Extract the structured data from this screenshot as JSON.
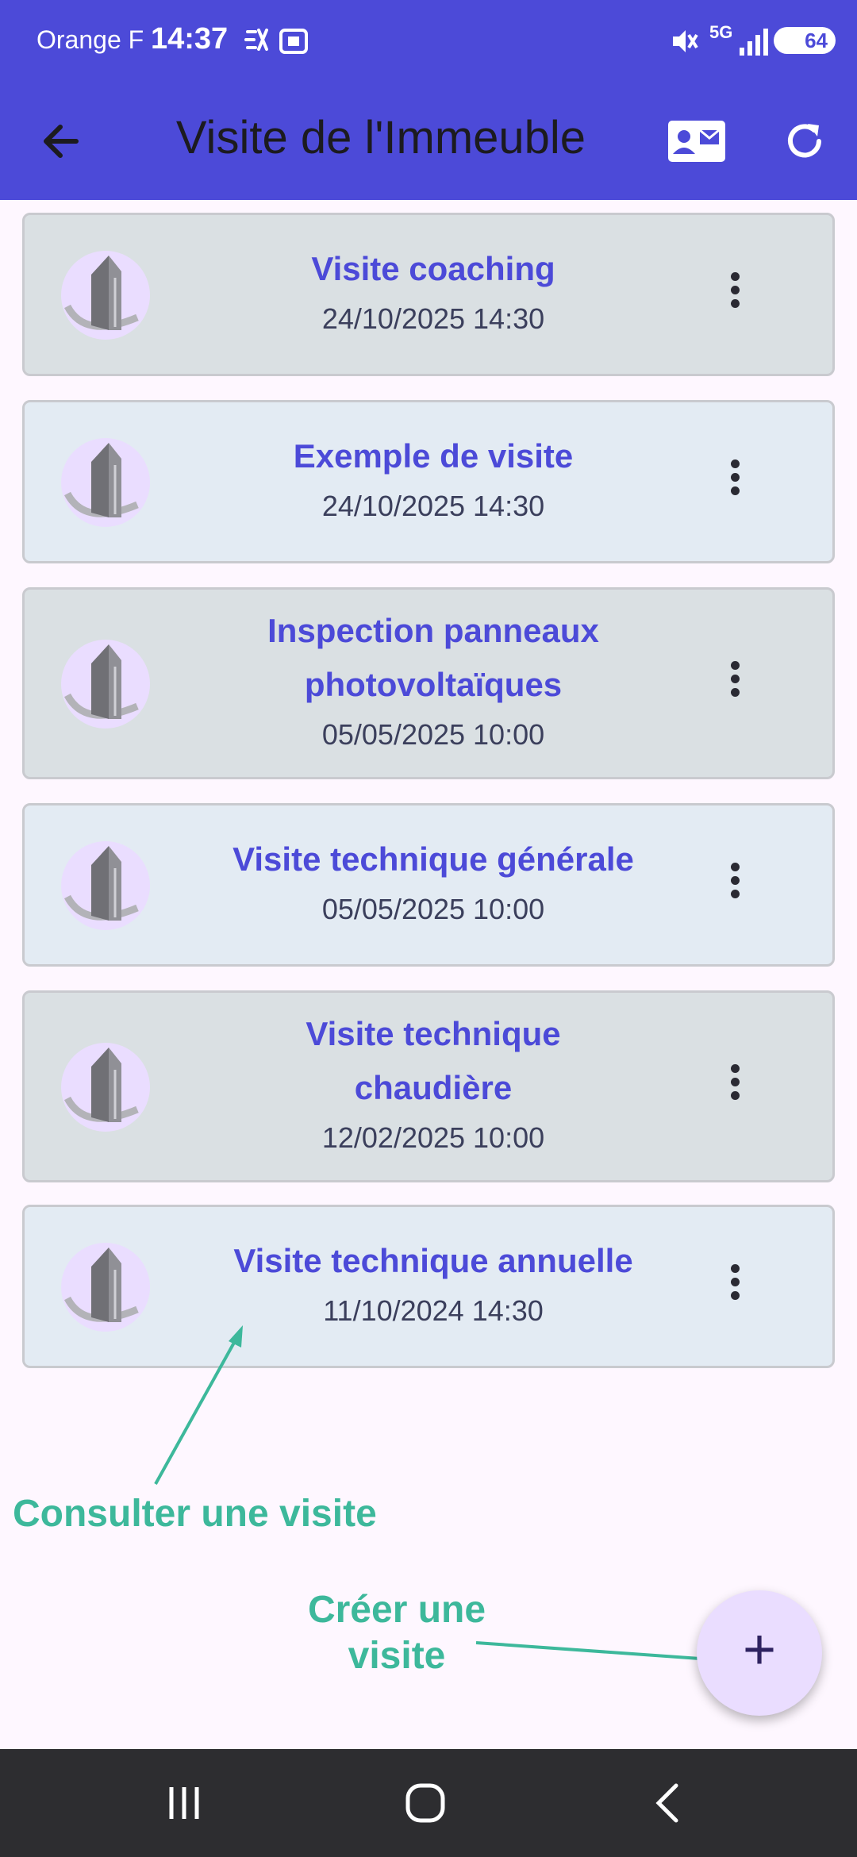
{
  "status_bar": {
    "carrier": "Orange F",
    "time": "14:37",
    "network": "5G",
    "battery": "64"
  },
  "app_bar": {
    "title": "Visite de l'Immeuble",
    "color": "#4C4AD8"
  },
  "visits": [
    {
      "title": "Visite coaching",
      "date": "24/10/2025 14:30"
    },
    {
      "title": "Exemple de visite",
      "date": "24/10/2025 14:30"
    },
    {
      "title": "Inspection panneaux photovoltaïques",
      "date": "05/05/2025 10:00"
    },
    {
      "title": "Visite technique générale",
      "date": "05/05/2025 10:00"
    },
    {
      "title": "Visite technique chaudière",
      "date": "12/02/2025 10:00"
    },
    {
      "title": "Visite technique annuelle",
      "date": "11/10/2024 14:30"
    }
  ],
  "annotations": {
    "consult": "Consulter une visite",
    "create": "Créer une visite",
    "color": "#3DB89B"
  },
  "fab": {
    "symbol": "+"
  },
  "icons": {
    "back": "arrow-left-icon",
    "contact": "contact-card-icon",
    "refresh": "refresh-icon",
    "avatar": "building-icon",
    "menu": "more-vertical-icon"
  }
}
